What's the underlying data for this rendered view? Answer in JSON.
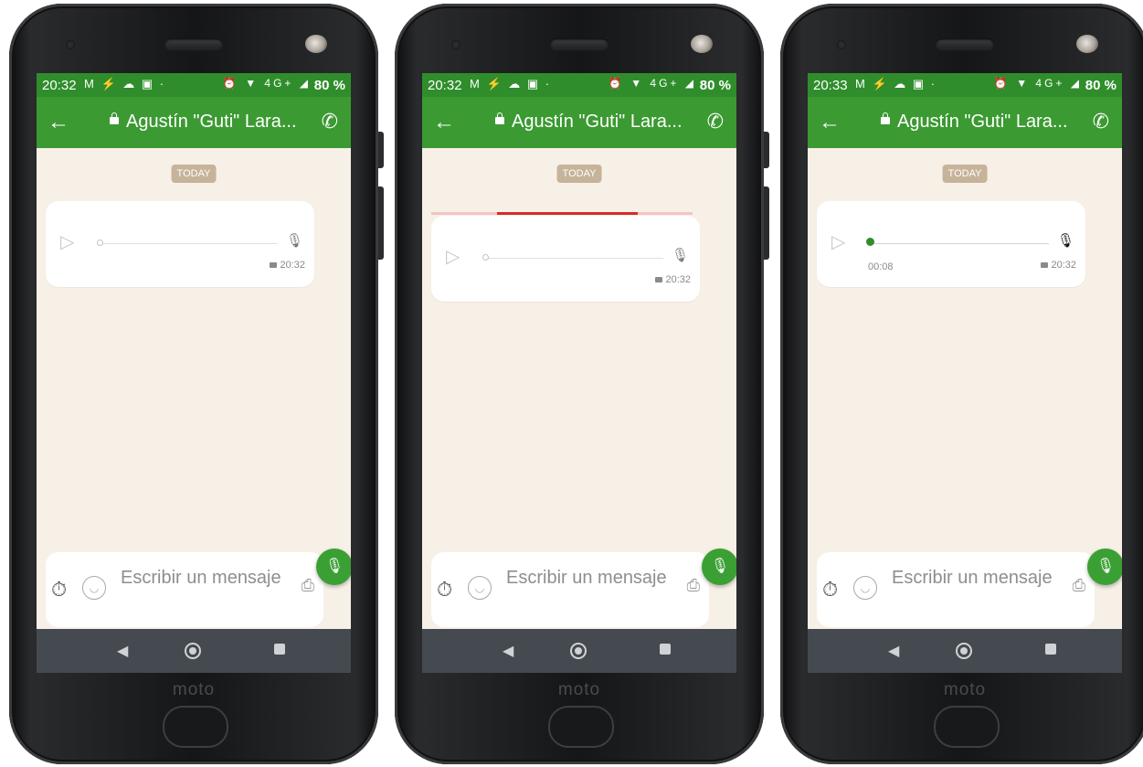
{
  "colors": {
    "status_bar": "#2f8e2b",
    "app_bar": "#3b9a32",
    "chat_bg": "#f7f0e7",
    "today_badge": "#c6b39a",
    "progress_red": "#d82b2b",
    "fab": "#3aa033",
    "nav_bar": "#444a50"
  },
  "phones": [
    {
      "status": {
        "time": "20:32",
        "left_icons": "M ⚡ ☁ ▣ ·",
        "right_icons": "⏰ ▼ 4G+ ◢",
        "battery": "80 %"
      },
      "header": {
        "back_icon": "arrow-left",
        "lock_icon": "lock",
        "title": "Agustín \"Guti\" Lara...",
        "call_icon": "phone"
      },
      "chat": {
        "date_badge": "TODAY",
        "voice_message": {
          "play_icon": "play",
          "mic_icon": "mic",
          "time": "20:32",
          "playback_fraction": 0
        }
      },
      "composer": {
        "timer_icon": "timer",
        "emoji_icon": "smiley",
        "placeholder": "Escribir un mensaje",
        "attach_icon": "paperclip",
        "send_icon": "mic"
      },
      "navbar": {
        "back": "◀",
        "home": "home",
        "recents": "square"
      },
      "brand": "moto"
    },
    {
      "status": {
        "time": "20:32",
        "left_icons": "M ⚡ ☁ ▣ ·",
        "right_icons": "⏰ ▼ 4G+ ◢",
        "battery": "80 %"
      },
      "header": {
        "back_icon": "arrow-left",
        "lock_icon": "lock",
        "title": "Agustín \"Guti\" Lara...",
        "call_icon": "phone"
      },
      "chat": {
        "date_badge": "TODAY",
        "loading_progress": {
          "start": 0.25,
          "end": 0.79
        },
        "voice_message": {
          "play_icon": "play",
          "mic_icon": "mic",
          "time": "20:32",
          "playback_fraction": 0
        }
      },
      "composer": {
        "timer_icon": "timer",
        "emoji_icon": "smiley",
        "placeholder": "Escribir un mensaje",
        "attach_icon": "paperclip",
        "send_icon": "mic"
      },
      "navbar": {
        "back": "◀",
        "home": "home",
        "recents": "square"
      },
      "brand": "moto"
    },
    {
      "status": {
        "time": "20:33",
        "left_icons": "M ⚡ ☁ ▣ ·",
        "right_icons": "⏰ ▼ 4G+ ◢",
        "battery": "80 %"
      },
      "header": {
        "back_icon": "arrow-left",
        "lock_icon": "lock",
        "title": "Agustín \"Guti\" Lara...",
        "call_icon": "phone"
      },
      "chat": {
        "date_badge": "TODAY",
        "voice_message": {
          "play_icon": "play",
          "mic_icon": "mic",
          "time": "20:32",
          "duration": "00:08",
          "playback_fraction": 0
        }
      },
      "composer": {
        "timer_icon": "timer",
        "emoji_icon": "smiley",
        "placeholder": "Escribir un mensaje",
        "attach_icon": "paperclip",
        "send_icon": "mic"
      },
      "navbar": {
        "back": "◀",
        "home": "home",
        "recents": "square"
      },
      "brand": "moto"
    }
  ]
}
